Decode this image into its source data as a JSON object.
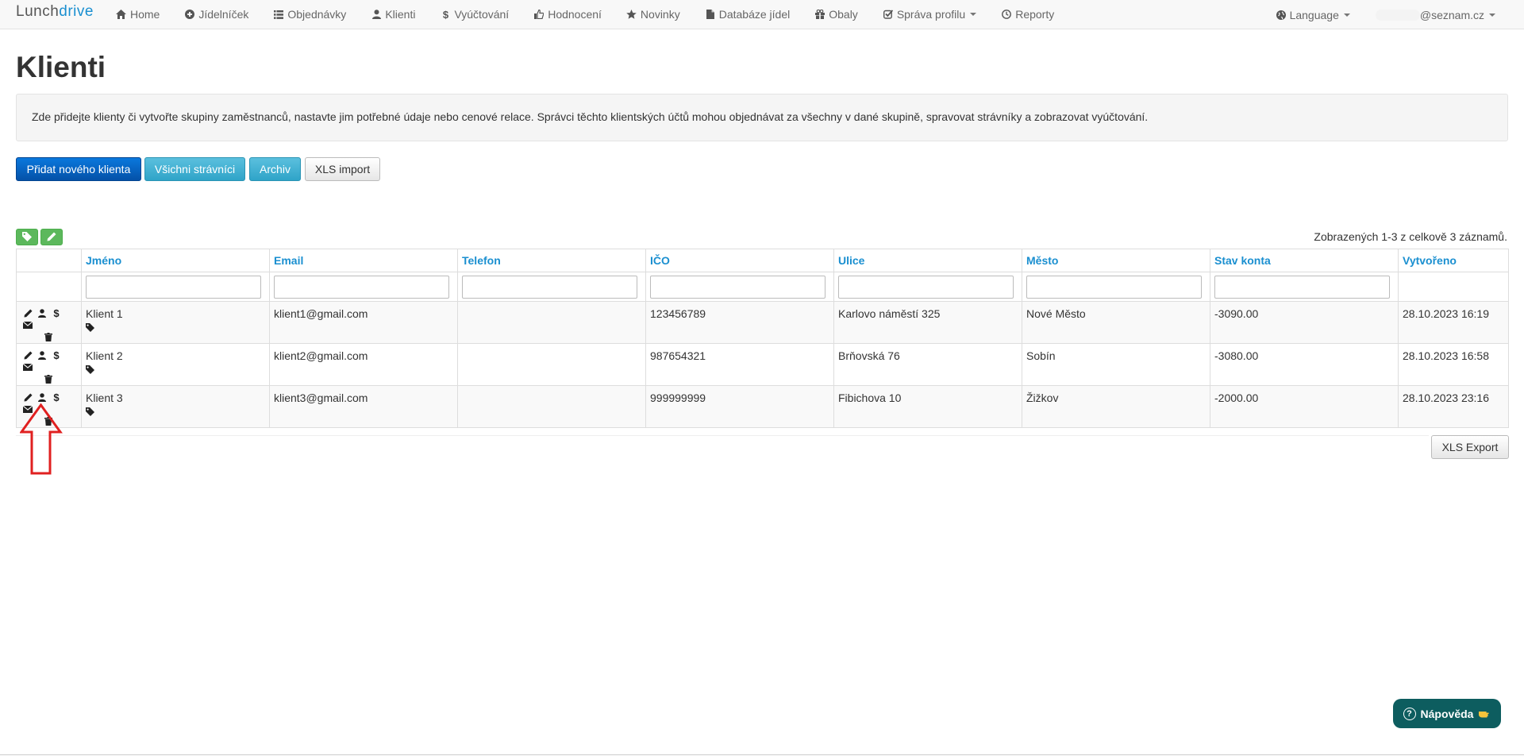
{
  "brand": {
    "part1": "Lunch",
    "part2": "drive"
  },
  "nav": {
    "items": [
      {
        "label": "Home",
        "icon": "home-icon"
      },
      {
        "label": "Jídelníček",
        "icon": "plus-circle-icon"
      },
      {
        "label": "Objednávky",
        "icon": "list-icon"
      },
      {
        "label": "Klienti",
        "icon": "user-icon"
      },
      {
        "label": "Vyúčtování",
        "icon": "dollar-icon"
      },
      {
        "label": "Hodnocení",
        "icon": "thumbs-up-icon"
      },
      {
        "label": "Novinky",
        "icon": "star-icon"
      },
      {
        "label": "Databáze jídel",
        "icon": "file-icon"
      },
      {
        "label": "Obaly",
        "icon": "gift-icon"
      },
      {
        "label": "Správa profilu",
        "icon": "check-square-icon"
      },
      {
        "label": "Reporty",
        "icon": "clock-icon"
      }
    ],
    "language": "Language",
    "user": "@seznam.cz"
  },
  "page": {
    "title": "Klienti",
    "info": "Zde přidejte klienty či vytvořte skupiny zaměstnanců, nastavte jim potřebné údaje nebo cenové relace. Správci těchto klientských účtů mohou objednávat za všechny v dané skupině, spravovat strávníky a zobrazovat vyúčtování."
  },
  "buttons": {
    "add_client": "Přidat nového klienta",
    "all_diners": "Všichni strávníci",
    "archive": "Archiv",
    "xls_import": "XLS import",
    "xls_export": "XLS Export",
    "help": "Nápověda"
  },
  "summary": "Zobrazených 1-3 z celkově 3 záznamů.",
  "table": {
    "headers": [
      "Jméno",
      "Email",
      "Telefon",
      "IČO",
      "Ulice",
      "Město",
      "Stav konta",
      "Vytvořeno"
    ],
    "rows": [
      [
        "Klient 1",
        "klient1@gmail.com",
        "",
        "123456789",
        "Karlovo náměstí 325",
        "Nové Město",
        "-3090.00",
        "28.10.2023 16:19"
      ],
      [
        "Klient 2",
        "klient2@gmail.com",
        "",
        "987654321",
        "Brňovská 76",
        "Sobín",
        "-3080.00",
        "28.10.2023 16:58"
      ],
      [
        "Klient 3",
        "klient3@gmail.com",
        "",
        "999999999",
        "Fibichova 10",
        "Žižkov",
        "-2000.00",
        "28.10.2023 23:16"
      ]
    ]
  },
  "colors": {
    "accent": "#1a8fd0",
    "primary": "#0562c2",
    "info": "#46b8da",
    "green": "#5cb85c",
    "help": "#0d5d5f",
    "annotation_arrow": "#e02020"
  }
}
